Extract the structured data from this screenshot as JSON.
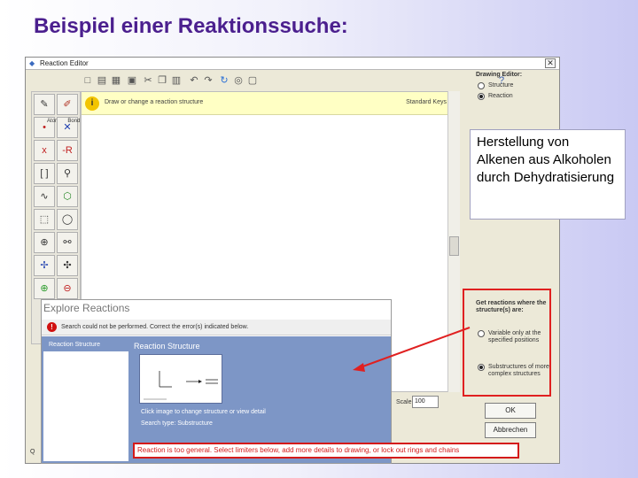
{
  "slide": {
    "title": "Beispiel einer Reaktionssuche:"
  },
  "editor": {
    "window_title": "Reaction Editor",
    "close_glyph": "✕",
    "hint_text": "Draw or change a reaction structure",
    "hint_right": "Standard Keys",
    "help_glyph": "?"
  },
  "palette": {
    "label_atom": "Atom",
    "label_bond": "Bond"
  },
  "right_panel": {
    "drawing_editor_label": "Drawing Editor:",
    "opt_structure": "Structure",
    "opt_reaction": "Reaction",
    "get_reactions_label": "Get reactions where the structure(s) are:",
    "opt_variable": "Variable only at the specified positions",
    "opt_substructures": "Substructures of more complex structures",
    "ok_label": "OK",
    "cancel_label": "Abbrechen",
    "scale_label": "Scale",
    "scale_value": "100"
  },
  "callout": {
    "text": "Herstellung von Alkenen aus Alkoholen durch Dehydratisierung"
  },
  "explore": {
    "title": "Explore Reactions",
    "error_msg": "Search could not be performed. Correct the error(s) indicated below.",
    "left_header": "Reaction Structure",
    "right_title": "Reaction Structure",
    "caption1": "Click image to change structure or view detail",
    "caption2": "Search type: Substructure"
  },
  "banner": {
    "text": "Reaction is too general. Select limiters below, add more details to drawing, or lock out rings and chains"
  },
  "bottom": {
    "field_label": "Q"
  },
  "colors": {
    "title": "#4b1f8e",
    "error_red": "#d41a1a",
    "panel_blue": "#7d96c6",
    "hint_yellow": "#ffffc4"
  }
}
